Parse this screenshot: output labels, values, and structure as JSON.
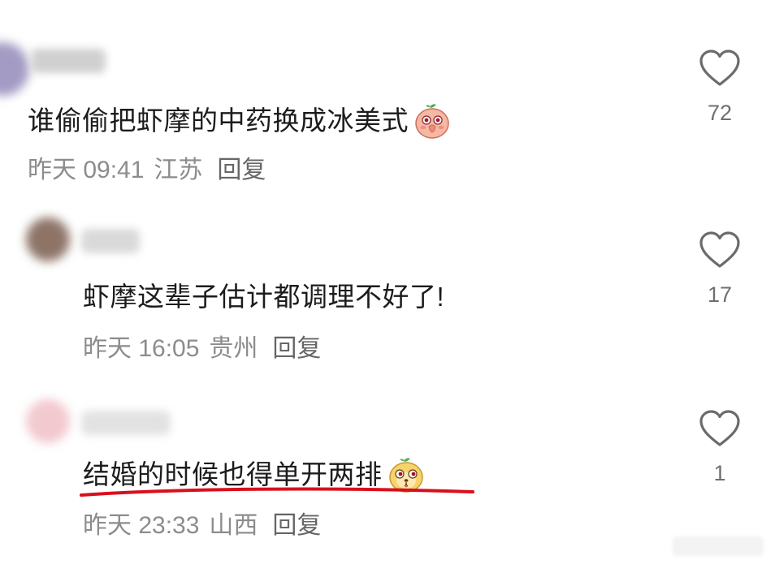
{
  "comments": [
    {
      "text": "谁偷偷把虾摩的中药换成冰美式",
      "emoji": "shy-peach-emoji",
      "time": "昨天 09:41",
      "location": "江苏",
      "reply_label": "回复",
      "like_count": "72"
    },
    {
      "text": "虾摩这辈子估计都调理不好了!",
      "time": "昨天 16:05",
      "location": "贵州",
      "reply_label": "回复",
      "like_count": "17"
    },
    {
      "text": "结婚的时候也得单开两排",
      "emoji": "yellow-smirk-emoji",
      "time": "昨天 23:33",
      "location": "山西",
      "reply_label": "回复",
      "like_count": "1",
      "highlight_color": "#d8101c"
    }
  ],
  "colors": {
    "text": "#1c1c1c",
    "meta": "#8c8c8c",
    "heart_outline": "#6b6b6b"
  }
}
